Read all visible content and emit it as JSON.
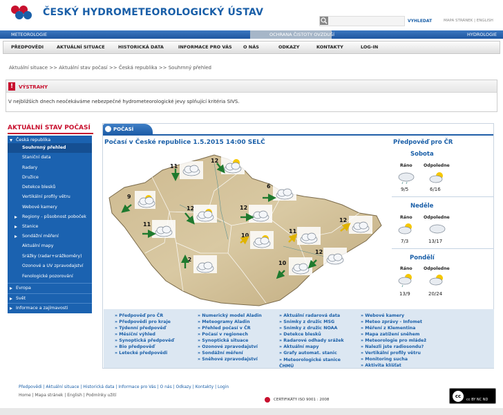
{
  "header": {
    "title": "ČESKÝ HYDROMETEOROLOGICKÝ ÚSTAV",
    "search_button": "VYHLEDAT",
    "links": "MAPA STRÁNEK  |  ENGLISH",
    "band_left": "METEOROLOGIE",
    "band_mid": "OCHRANA ČISTOTY OVZDUŠÍ",
    "band_right": "HYDROLOGIE"
  },
  "nav": [
    "PŘEDPOVĚDI",
    "AKTUÁLNÍ SITUACE",
    "HISTORICKÁ DATA",
    "INFORMACE PRO VÁS",
    "O NÁS",
    "ODKAZY",
    "KONTAKTY",
    "LOG-IN"
  ],
  "breadcrumb": "Aktuální situace  >> Aktuální stav počasí  >> Česká republika  >> Souhrnný přehled",
  "warning": {
    "title": "VÝSTRAHY",
    "text": "V nejbližších dnech neočekáváme nebezpečné hydrometeorologické jevy splňující kritéria SIVS."
  },
  "sidebar": {
    "title": "AKTUÁLNÍ STAV POČASÍ",
    "items": [
      "Česká republika",
      "Souhrnný přehled",
      "Staniční data",
      "Radary",
      "Družice",
      "Detekce blesků",
      "Vertikální profily větru",
      "Webové kamery",
      "Regiony - působnost poboček",
      "Stanice",
      "Sondážní měření",
      "Aktuální mapy",
      "Srážky (radar+srážkoměry)",
      "Ozonové a UV zpravodajství",
      "Fenologické pozorování",
      "Evropa",
      "Svět",
      "Informace a zajímavosti"
    ]
  },
  "panel": {
    "tab": "POČASÍ",
    "map_title": "Počasí v České republice 1.5.2015 14:00 SELČ",
    "stations": [
      "11",
      "12",
      "9",
      "12",
      "6",
      "12",
      "11",
      "10",
      "11",
      "12",
      "12",
      "10",
      "12"
    ]
  },
  "forecast": {
    "title": "Předpověď pro ČR",
    "morning": "Ráno",
    "afternoon": "Odpoledne",
    "days": [
      {
        "name": "Sobota",
        "morning": "9/5",
        "afternoon": "6/16"
      },
      {
        "name": "Neděle",
        "morning": "7/3",
        "afternoon": "13/17"
      },
      {
        "name": "Pondělí",
        "morning": "13/9",
        "afternoon": "20/24"
      }
    ]
  },
  "links": {
    "col1": [
      "Předpověď pro ČR",
      "Předpovědi pro kraje",
      "Týdenní předpověď",
      "Měsíční výhled",
      "Synoptická předpověď",
      "Bio předpověď",
      "Letecké předpovědi"
    ],
    "col2": [
      "Numerický model Aladin",
      "Meteogramy Aladin",
      "Přehled počasí v ČR",
      "Počasí v regionech",
      "Synoptická situace",
      "Ozonové zpravodajství",
      "Sondážní měření",
      "Sněhové zpravodajství"
    ],
    "col3": [
      "Aktuální radarová data",
      "Snímky z družic MSG",
      "Snímky z družic NOAA",
      "Detekce blesků",
      "Radarové odhady srážek",
      "Aktuální mapy",
      "Grafy automat. stanic",
      "Meteorologické stanice ČHMÚ"
    ],
    "col4": [
      "Webové kamery",
      "Meteo zprávy - Infomet",
      "Měření z Klementina",
      "Mapa zatížení sněhem",
      "Meteorologie pro mládež",
      "Nalezli jste radiosondu?",
      "Vertikální profily větru",
      "Monitoring sucha",
      "Aktivita klíšťat"
    ]
  },
  "footer": {
    "line1": "Předpovědi  |  Aktuální situace  |  Historická data  |  Informace pro Vás  |  O nás  |  Odkazy  |  Kontakty  |  Login",
    "line2": "Home  |  Mapa stránek  |  English  |  Podmínky užití",
    "cert": "CERTIFIKÁTY   ISO   9001 : 2008",
    "cc": "cc BY NC ND"
  }
}
